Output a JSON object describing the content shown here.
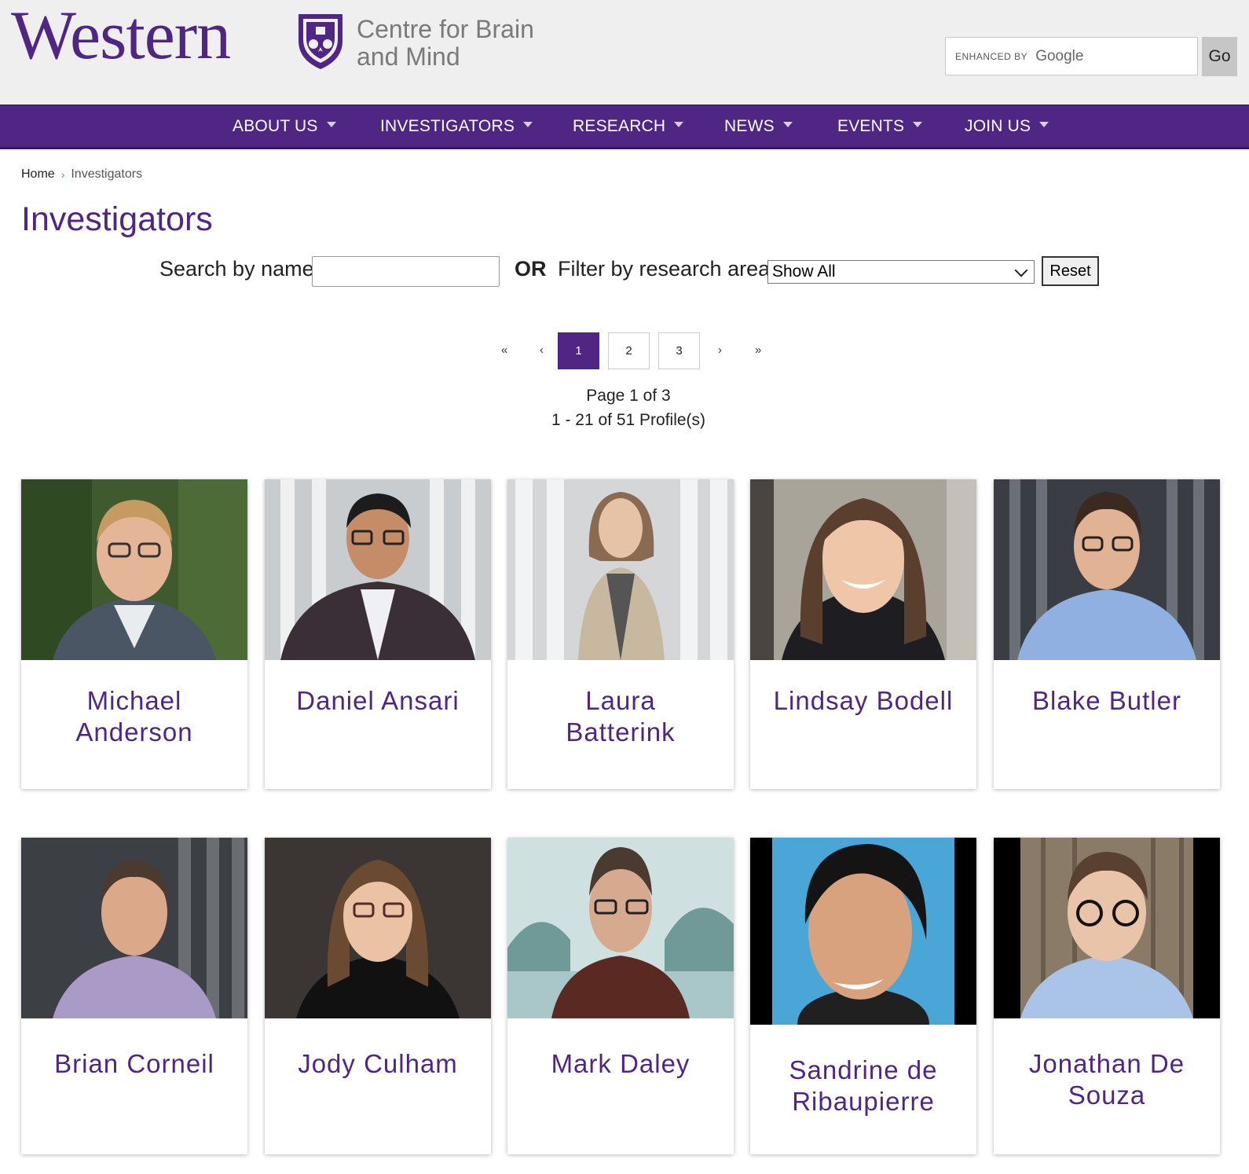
{
  "header": {
    "logo_word": "Western",
    "centre_line1": "Centre for Brain",
    "centre_line2": "and Mind",
    "search_enhanced": "ENHANCED BY",
    "search_google": "Google",
    "go_label": "Go"
  },
  "nav": {
    "items": [
      {
        "label": "ABOUT US"
      },
      {
        "label": "INVESTIGATORS"
      },
      {
        "label": "RESEARCH"
      },
      {
        "label": "NEWS"
      },
      {
        "label": "EVENTS"
      },
      {
        "label": "JOIN US"
      }
    ]
  },
  "breadcrumb": {
    "home": "Home",
    "sep": "›",
    "current": "Investigators"
  },
  "page_title": "Investigators",
  "filters": {
    "search_label": "Search by name",
    "name_value": "",
    "or_label": "OR",
    "filter_label": "Filter by research area",
    "area_selected": "Show All",
    "reset_label": "Reset"
  },
  "pager": {
    "first": "«",
    "prev": "‹",
    "pages": [
      "1",
      "2",
      "3"
    ],
    "active_page": "1",
    "next": "›",
    "last": "»",
    "page_text": "Page 1 of 3",
    "profiles_text": "1 - 21 of 51 Profile(s)"
  },
  "investigators": [
    {
      "name_l1": "Michael",
      "name_l2": "Anderson"
    },
    {
      "name_l1": "Daniel Ansari",
      "name_l2": ""
    },
    {
      "name_l1": "Laura",
      "name_l2": "Batterink"
    },
    {
      "name_l1": "Lindsay Bodell",
      "name_l2": ""
    },
    {
      "name_l1": "Blake Butler",
      "name_l2": ""
    },
    {
      "name_l1": "Brian Corneil",
      "name_l2": ""
    },
    {
      "name_l1": "Jody Culham",
      "name_l2": ""
    },
    {
      "name_l1": "Mark Daley",
      "name_l2": ""
    },
    {
      "name_l1": "Sandrine de",
      "name_l2": "Ribaupierre"
    },
    {
      "name_l1": "Jonathan De",
      "name_l2": "Souza"
    }
  ],
  "colors": {
    "brand_purple": "#4f2683",
    "header_bg": "#efefef",
    "link_blue": "#2a9fd6"
  }
}
